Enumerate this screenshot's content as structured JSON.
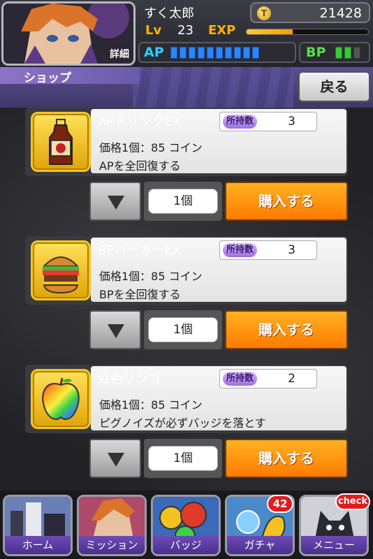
{
  "player": {
    "name": "すく太郎",
    "detail_label": "詳細",
    "coins": "21428",
    "coin_icon_letter": "T",
    "level_label": "Lv",
    "level": "23",
    "exp_label": "EXP",
    "exp_progress_fraction": 0.38,
    "ap_label": "AP",
    "ap_filled_segments": 10,
    "ap_total_segments": 10,
    "bp_label": "BP",
    "bp_filled_segments": 2,
    "bp_total_segments": 3
  },
  "title_bar": {
    "title": "ショップ",
    "back_label": "戻る"
  },
  "items": [
    {
      "name": "APドリンクEX",
      "own_label": "所持数",
      "own_count": "3",
      "price": "価格1個：85 コイン",
      "description": "APを全回復する",
      "quantity": "1個",
      "buy_label": "購入する",
      "icon": "drink-bottle-icon"
    },
    {
      "name": "BPバーガーEX",
      "own_label": "所持数",
      "own_count": "3",
      "price": "価格1個：85 コイン",
      "description": "BPを全回復する",
      "quantity": "1個",
      "buy_label": "購入する",
      "icon": "burger-icon"
    },
    {
      "name": "虹色リンゴ",
      "own_label": "所持数",
      "own_count": "2",
      "price": "価格1個：85 コイン",
      "description": "ピグノイズが必ずバッジを落とす",
      "quantity": "1個",
      "buy_label": "購入する",
      "icon": "rainbow-apple-icon"
    }
  ],
  "bottom_nav": [
    {
      "label": "ホーム",
      "icon": "home-icon"
    },
    {
      "label": "ミッション",
      "icon": "mission-icon"
    },
    {
      "label": "バッジ",
      "icon": "badge-icon"
    },
    {
      "label": "ガチャ",
      "icon": "gacha-icon",
      "badge": "42"
    },
    {
      "label": "メニュー",
      "icon": "menu-icon",
      "badge": "check"
    }
  ],
  "colors": {
    "accent_orange": "#ff9a00",
    "ap_blue": "#2a86ff",
    "bp_green": "#38c838",
    "nav_purple": "#6d4bb8"
  }
}
